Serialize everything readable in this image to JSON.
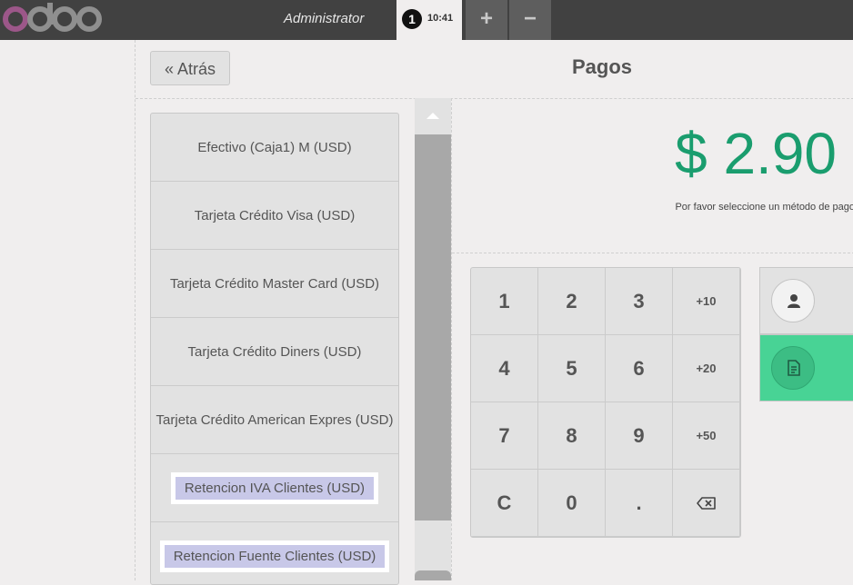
{
  "header": {
    "user": "Administrator",
    "order": {
      "number": "1",
      "time": "10:41"
    },
    "add_order": "+",
    "remove_order": "−"
  },
  "payment": {
    "back_label": "« Atrás",
    "title": "Pagos",
    "amount_due": "$ 2.90",
    "hint": "Por favor seleccione un método de pago"
  },
  "methods": [
    "Efectivo (Caja1) M (USD)",
    "Tarjeta Crédito Visa (USD)",
    "Tarjeta Crédito Master Card (USD)",
    "Tarjeta Crédito Diners (USD)",
    "Tarjeta Crédito American Expres (USD)",
    "Retencion IVA Clientes (USD)",
    "Retencion Fuente Clientes (USD)"
  ],
  "numpad": {
    "keys": [
      "1",
      "2",
      "3",
      "+10",
      "4",
      "5",
      "6",
      "+20",
      "7",
      "8",
      "9",
      "+50",
      "C",
      "0",
      "."
    ]
  },
  "colors": {
    "topbar": "#414141",
    "amount": "#1a9d6e",
    "invoice": "#48d395",
    "highlight": "#c8c8e8",
    "logo": "#875a7b"
  },
  "icons": [
    "odoo-logo",
    "user-icon",
    "invoice-icon",
    "backspace-icon",
    "scroll-up-icon"
  ]
}
